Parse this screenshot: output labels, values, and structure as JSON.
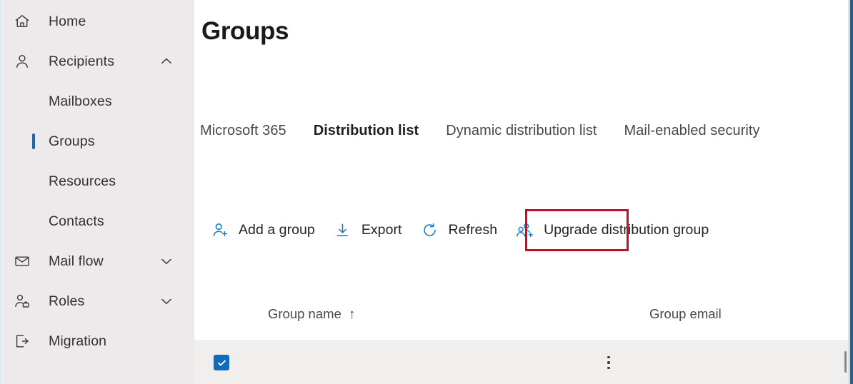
{
  "sidebar": {
    "items": [
      {
        "label": "Home",
        "icon": "home-icon",
        "level": "top",
        "chevron": "none",
        "selected": false
      },
      {
        "label": "Recipients",
        "icon": "person-icon",
        "level": "top",
        "chevron": "up",
        "selected": false
      },
      {
        "label": "Mailboxes",
        "icon": "",
        "level": "sub",
        "chevron": "none",
        "selected": false
      },
      {
        "label": "Groups",
        "icon": "",
        "level": "sub",
        "chevron": "none",
        "selected": true
      },
      {
        "label": "Resources",
        "icon": "",
        "level": "sub",
        "chevron": "none",
        "selected": false
      },
      {
        "label": "Contacts",
        "icon": "",
        "level": "sub",
        "chevron": "none",
        "selected": false
      },
      {
        "label": "Mail flow",
        "icon": "envelope-icon",
        "level": "top",
        "chevron": "down",
        "selected": false
      },
      {
        "label": "Roles",
        "icon": "person-briefcase-icon",
        "level": "top",
        "chevron": "down",
        "selected": false
      },
      {
        "label": "Migration",
        "icon": "migration-icon",
        "level": "top",
        "chevron": "none",
        "selected": false
      }
    ]
  },
  "header": {
    "title": "Groups"
  },
  "tabs": [
    {
      "label": "Microsoft 365",
      "active": false
    },
    {
      "label": "Distribution list",
      "active": true
    },
    {
      "label": "Dynamic distribution list",
      "active": false
    },
    {
      "label": "Mail-enabled security",
      "active": false
    }
  ],
  "commandbar": [
    {
      "label": "Add a group",
      "icon": "person-add-icon"
    },
    {
      "label": "Export",
      "icon": "download-arrow-icon"
    },
    {
      "label": "Refresh",
      "icon": "refresh-circle-icon"
    },
    {
      "label": "Upgrade distribution group",
      "icon": "people-add-icon"
    }
  ],
  "highlight": {
    "target": "Export",
    "color": "#c40c2b"
  },
  "table": {
    "columns": [
      {
        "label": "Group name",
        "sort": "ascending",
        "sort_glyph": "↑"
      },
      {
        "label": "Group email",
        "sort": "none",
        "sort_glyph": ""
      }
    ],
    "rows": [
      {
        "selected": true,
        "group_name": "",
        "group_email": "",
        "more_menu": "⋮"
      }
    ]
  },
  "colors": {
    "accent": "#0f6cbd",
    "icon_blue": "#1279c6",
    "sidebar_bg": "#eceaea",
    "row_bg": "#f0efee",
    "highlight_red": "#c40c2b"
  }
}
